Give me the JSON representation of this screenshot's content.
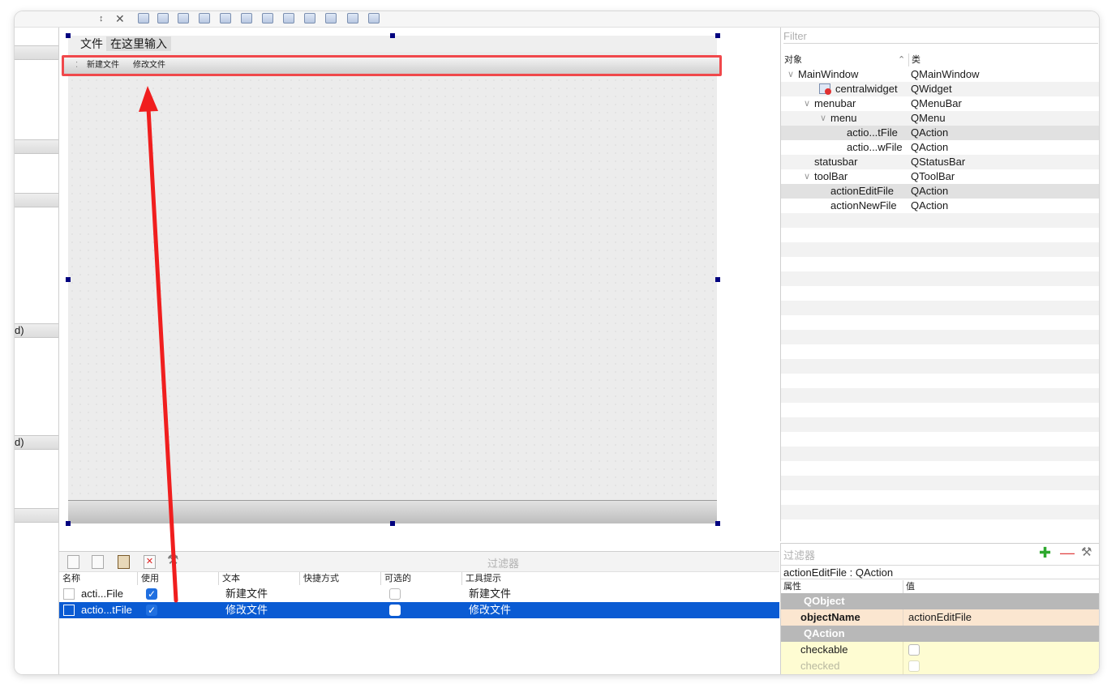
{
  "form": {
    "menubar": {
      "file_menu": "文件",
      "type_here": "在这里输入"
    },
    "toolbar": {
      "grip": "⁚",
      "new_file": "新建文件",
      "edit_file": "修改文件"
    }
  },
  "left_panel": {
    "category_suffix_1": "d)",
    "category_suffix_2": "d)"
  },
  "action_editor": {
    "filter_placeholder": "过滤器",
    "headers": {
      "name": "名称",
      "used": "使用",
      "text": "文本",
      "shortcut": "快捷方式",
      "checkable": "可选的",
      "tooltip": "工具提示"
    },
    "rows": [
      {
        "name": "acti...File",
        "used": true,
        "text": "新建文件",
        "shortcut": "",
        "checkable": false,
        "tooltip": "新建文件",
        "selected": false
      },
      {
        "name": "actio...tFile",
        "used": true,
        "text": "修改文件",
        "shortcut": "",
        "checkable": false,
        "tooltip": "修改文件",
        "selected": true
      }
    ]
  },
  "object_inspector": {
    "filter_placeholder": "Filter",
    "headers": {
      "object": "对象",
      "class": "类"
    },
    "rows": [
      {
        "name": "MainWindow",
        "class": "QMainWindow",
        "depth": 0,
        "expanded": true
      },
      {
        "name": "centralwidget",
        "class": "QWidget",
        "depth": 1,
        "icon": "widget-icon"
      },
      {
        "name": "menubar",
        "class": "QMenuBar",
        "depth": 1,
        "expanded": true
      },
      {
        "name": "menu",
        "class": "QMenu",
        "depth": 2,
        "expanded": true
      },
      {
        "name": "actio...tFile",
        "class": "QAction",
        "depth": 3
      },
      {
        "name": "actio...wFile",
        "class": "QAction",
        "depth": 3
      },
      {
        "name": "statusbar",
        "class": "QStatusBar",
        "depth": 1
      },
      {
        "name": "toolBar",
        "class": "QToolBar",
        "depth": 1,
        "expanded": true
      },
      {
        "name": "actionEditFile",
        "class": "QAction",
        "depth": 2
      },
      {
        "name": "actionNewFile",
        "class": "QAction",
        "depth": 2
      }
    ]
  },
  "property_editor": {
    "filter_placeholder": "过滤器",
    "title": "actionEditFile : QAction",
    "headers": {
      "property": "属性",
      "value": "值"
    },
    "groups": {
      "qobject": "QObject",
      "qaction": "QAction"
    },
    "object_name_label": "objectName",
    "object_name_value": "actionEditFile",
    "checkable_label": "checkable",
    "checked_label": "checked"
  },
  "colors": {
    "highlight": "#1f6fe0",
    "arrow": "#f01e1e",
    "selection_frame": "#f0484b",
    "handle": "#00007f"
  }
}
